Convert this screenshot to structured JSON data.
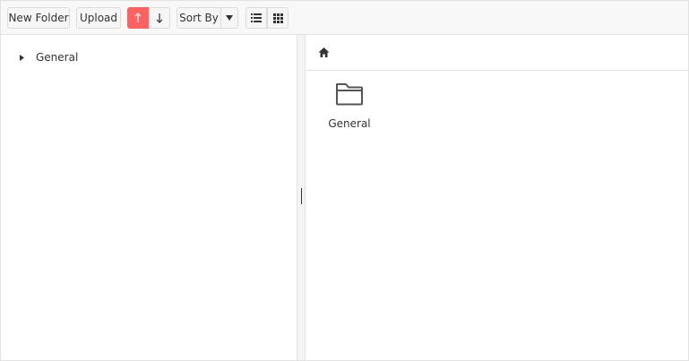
{
  "toolbar": {
    "new_folder_label": "New Folder",
    "upload_label": "Upload",
    "sort_by_label": "Sort By",
    "sort_ascending_icon": "arrow-up-icon",
    "sort_descending_icon": "arrow-down-icon",
    "sort_dropdown_icon": "caret-down-icon",
    "list_view_icon": "list-view-icon",
    "grid_view_icon": "grid-view-icon",
    "active_color": "#ff6161"
  },
  "tree": {
    "items": [
      {
        "label": "General",
        "icon": "caret-right-icon"
      }
    ]
  },
  "breadcrumb": {
    "icon": "home-icon"
  },
  "content": {
    "items": [
      {
        "label": "General",
        "icon": "folder-icon"
      }
    ]
  }
}
